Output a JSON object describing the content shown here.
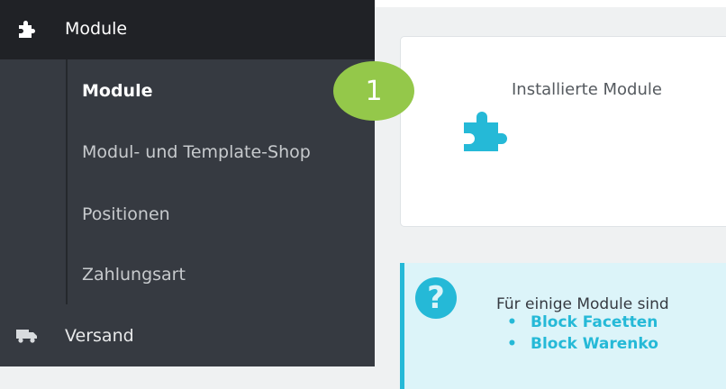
{
  "sidebar": {
    "top_item": {
      "label": "Module",
      "icon": "puzzle-icon"
    },
    "sub_items": [
      {
        "label": "Module",
        "current": true
      },
      {
        "label": "Modul- und Template-Shop"
      },
      {
        "label": "Positionen"
      },
      {
        "label": "Zahlungsart"
      }
    ],
    "next_item": {
      "label": "Versand",
      "icon": "truck-icon"
    }
  },
  "main": {
    "card": {
      "title": "Installierte Module",
      "icon": "puzzle-icon",
      "icon_color": "#25b9d7"
    },
    "alert": {
      "icon": "question-icon",
      "text": "Für einige Module sind",
      "items": [
        "Block Facetten",
        "Block Warenko"
      ]
    }
  },
  "annotation": {
    "step_number": "1",
    "color": "#94c84a"
  }
}
